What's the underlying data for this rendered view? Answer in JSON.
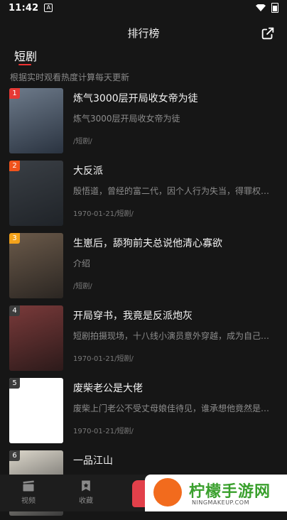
{
  "status": {
    "time": "11:42",
    "badge": "A"
  },
  "header": {
    "title": "排行榜"
  },
  "tabs": [
    {
      "label": "短剧"
    }
  ],
  "subtitle": "根据实时观看热度计算每天更新",
  "items": [
    {
      "rank": "1",
      "rank_color": "#e53935",
      "title": "炼气3000层开局收女帝为徒",
      "desc": "炼气3000层开局收女帝为徒",
      "meta": "/短剧/",
      "poster_colors": [
        "#6d7a8a",
        "#2a3340"
      ]
    },
    {
      "rank": "2",
      "rank_color": "#f0531c",
      "title": "大反派",
      "desc": "殷悟道，曾经的富二代，因个人行为失当，得罪权贵…",
      "meta": "1970-01-21/短剧/",
      "poster_colors": [
        "#3a3f45",
        "#1f2328"
      ]
    },
    {
      "rank": "3",
      "rank_color": "#f3a21b",
      "title": "生崽后，舔狗前夫总说他清心寡欲",
      "desc": "介绍",
      "meta": "/短剧/",
      "poster_colors": [
        "#6b5a4a",
        "#2b2622"
      ]
    },
    {
      "rank": "4",
      "rank_color": "#3c3c3c",
      "title": "开局穿书，我竟是反派炮灰",
      "desc": "短剧拍摄现场，十八线小演员意外穿越，成为自己饰…",
      "meta": "1970-01-21/短剧/",
      "poster_colors": [
        "#7a3a3a",
        "#2c1a1a"
      ]
    },
    {
      "rank": "5",
      "rank_color": "#3c3c3c",
      "title": "废柴老公是大佬",
      "desc": "废柴上门老公不受丈母娘佳待见，谁承想他竟然是隐…",
      "meta": "1970-01-21/短剧/",
      "poster_colors": [
        "#ffffff",
        "#ffffff"
      ]
    },
    {
      "rank": "6",
      "rank_color": "#3c3c3c",
      "title": "一品江山",
      "desc": "",
      "meta": "",
      "poster_colors": [
        "#ddd8cc",
        "#3a3a3a"
      ]
    }
  ],
  "bottom_nav": [
    {
      "label": "视频",
      "icon": "clapperboard-icon"
    },
    {
      "label": "收藏",
      "icon": "bookmark-star-icon"
    }
  ],
  "watermark": {
    "title": "柠檬手游网",
    "url": "NINGMAKEUP.COM"
  },
  "colors": {
    "background": "#161616",
    "accent": "#e33333"
  }
}
